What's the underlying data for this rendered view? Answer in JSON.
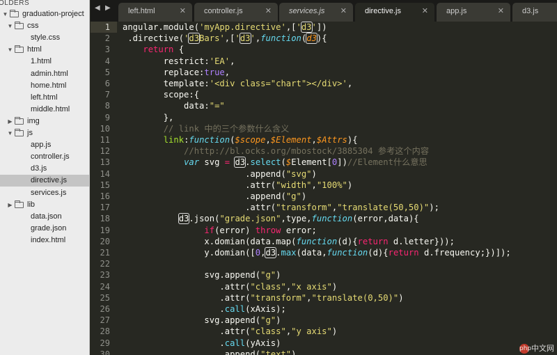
{
  "sidebar": {
    "header": "OLDERS",
    "items": [
      {
        "label": "graduation-project",
        "type": "folder",
        "open": true,
        "depth": 0
      },
      {
        "label": "css",
        "type": "folder",
        "open": true,
        "depth": 1
      },
      {
        "label": "style.css",
        "type": "file",
        "depth": 2
      },
      {
        "label": "html",
        "type": "folder",
        "open": true,
        "depth": 1
      },
      {
        "label": "1.html",
        "type": "file",
        "depth": 2
      },
      {
        "label": "admin.html",
        "type": "file",
        "depth": 2
      },
      {
        "label": "home.html",
        "type": "file",
        "depth": 2
      },
      {
        "label": "left.html",
        "type": "file",
        "depth": 2
      },
      {
        "label": "middle.html",
        "type": "file",
        "depth": 2
      },
      {
        "label": "img",
        "type": "folder",
        "open": false,
        "depth": 1
      },
      {
        "label": "js",
        "type": "folder",
        "open": true,
        "depth": 1
      },
      {
        "label": "app.js",
        "type": "file",
        "depth": 2
      },
      {
        "label": "controller.js",
        "type": "file",
        "depth": 2
      },
      {
        "label": "d3.js",
        "type": "file",
        "depth": 2
      },
      {
        "label": "directive.js",
        "type": "file",
        "depth": 2,
        "selected": true
      },
      {
        "label": "services.js",
        "type": "file",
        "depth": 2
      },
      {
        "label": "lib",
        "type": "folder",
        "open": false,
        "depth": 1
      },
      {
        "label": "data.json",
        "type": "file",
        "depth": 1
      },
      {
        "label": "grade.json",
        "type": "file",
        "depth": 1
      },
      {
        "label": "index.html",
        "type": "file",
        "depth": 1
      }
    ]
  },
  "tabbar": {
    "prev_icon": "◀",
    "next_icon": "▶",
    "close_icon": "✕",
    "tabs": [
      {
        "label": "left.html",
        "active": false,
        "italic": false
      },
      {
        "label": "controller.js",
        "active": false,
        "italic": false
      },
      {
        "label": "services.js",
        "active": false,
        "italic": true
      },
      {
        "label": "directive.js",
        "active": true,
        "italic": false
      },
      {
        "label": "app.js",
        "active": false,
        "italic": false
      },
      {
        "label": "d3.js",
        "active": false,
        "italic": false
      }
    ]
  },
  "editor": {
    "line_numbers": [
      "1",
      "2",
      "3",
      "4",
      "5",
      "6",
      "7",
      "8",
      "9",
      "10",
      "11",
      "12",
      "13",
      "14",
      "15",
      "16",
      "17",
      "18",
      "19",
      "20",
      "21",
      "22",
      "23",
      "24",
      "25",
      "26",
      "27",
      "28",
      "29",
      "30"
    ],
    "current_line": "1"
  },
  "watermark": {
    "logo": "php",
    "text": "中文网"
  },
  "colors": {
    "background": "#272822",
    "string": "#e6db74",
    "keyword": "#f92672",
    "function": "#66d9ef",
    "param": "#fd971f",
    "comment": "#75715e",
    "identifier": "#a6e22e",
    "number": "#ae81ff"
  }
}
